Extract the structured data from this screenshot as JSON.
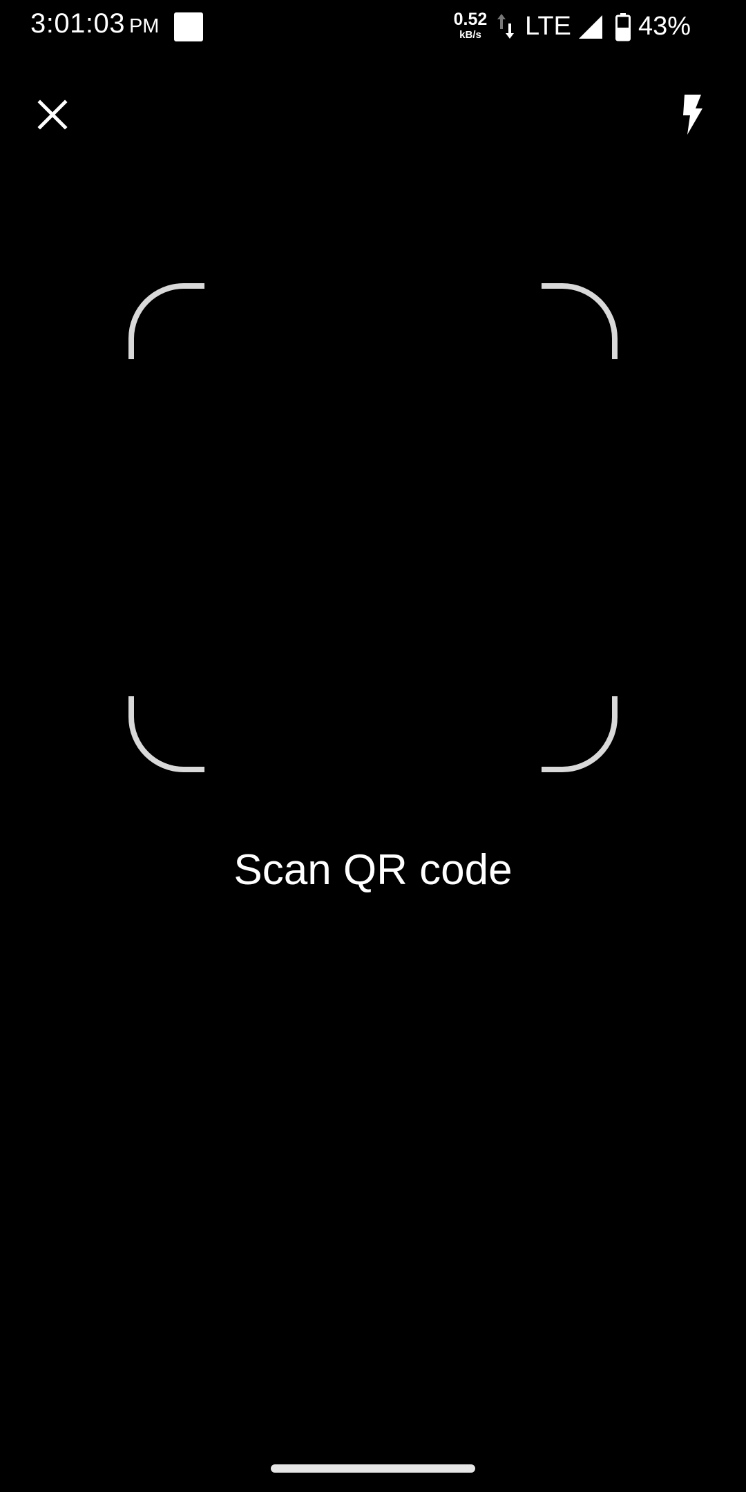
{
  "status_bar": {
    "time": "3:01:03",
    "ampm": "PM",
    "net_speed_value": "0.52",
    "net_speed_unit": "kB/s",
    "network_type": "LTE",
    "battery_percent": "43%",
    "icons": [
      "notification-square-icon",
      "data-activity-arrows-icon",
      "cell-signal-icon",
      "battery-icon"
    ]
  },
  "toolbar": {
    "close_icon": "close-icon",
    "flash_icon": "flash-icon"
  },
  "scanner": {
    "prompt": "Scan QR code",
    "frame_color": "#d9d9d9"
  },
  "colors": {
    "background": "#000000",
    "foreground": "#ffffff"
  }
}
